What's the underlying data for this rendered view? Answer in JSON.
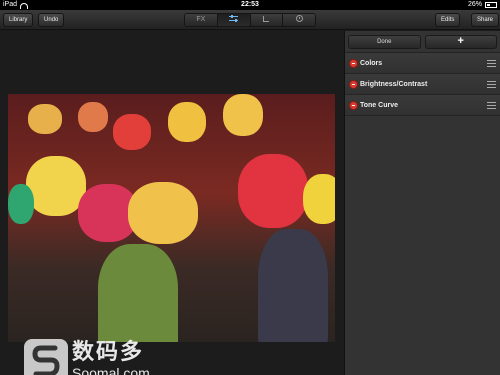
{
  "status_bar": {
    "device": "iPad",
    "time": "22:53",
    "battery": "26%"
  },
  "toolbar": {
    "library_label": "Library",
    "undo_label": "Undo",
    "fx_label": "FX",
    "active_tab": "adjust",
    "edits_label": "Edits",
    "share_label": "Share"
  },
  "panel": {
    "done_label": "Done",
    "add_label": "+",
    "items": [
      {
        "label": "Colors",
        "icon": "remove-icon"
      },
      {
        "label": "Brightness/Contrast",
        "icon": "remove-icon"
      },
      {
        "label": "Tone Curve",
        "icon": "remove-icon"
      }
    ]
  },
  "watermark": {
    "cn": "数码多",
    "en": "Soomal.com"
  },
  "colors": {
    "accent": "#6fb6f0",
    "remove": "#d93a2f"
  }
}
